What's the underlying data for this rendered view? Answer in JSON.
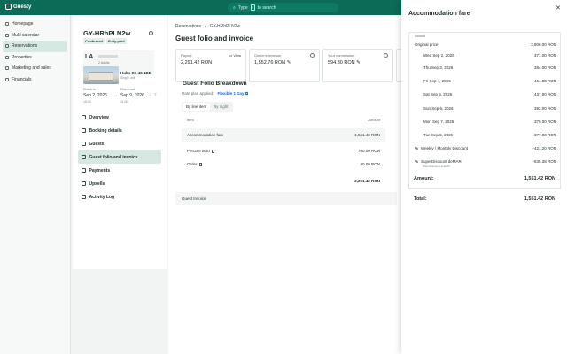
{
  "app": {
    "brand": "Guesty"
  },
  "search": {
    "label": "Type",
    "key": "/",
    "suffix": "to search"
  },
  "sidebar": {
    "items": [
      {
        "label": "Homepage"
      },
      {
        "label": "Multi calendar"
      },
      {
        "label": "Reservations"
      },
      {
        "label": "Properties"
      },
      {
        "label": "Marketing and sales"
      },
      {
        "label": "Financials"
      }
    ]
  },
  "reservation": {
    "code": "GY-HRhPLN2w",
    "status": "Confirmed",
    "payment": "Fully paid",
    "guest_initials": "LA",
    "guest_meta": "2 Adults",
    "unit_name": "Hubs C1-46 1BD",
    "unit_sub": "Single unit",
    "checkin_label": "Check-in",
    "checkin_date": "Sep 2, 2026",
    "checkin_time": "15:00",
    "checkout_label": "Check-out",
    "checkout_date": "Sep 9, 2026",
    "checkout_time": "11:00",
    "nights": "7",
    "nav": [
      {
        "label": "Overview"
      },
      {
        "label": "Booking details"
      },
      {
        "label": "Guests"
      },
      {
        "label": "Guest folio and invoice"
      },
      {
        "label": "Payments"
      },
      {
        "label": "Upsells"
      },
      {
        "label": "Activity Log"
      }
    ]
  },
  "main": {
    "breadcrumb": [
      "Reservations",
      "/",
      "GY-HRhPLN2w"
    ],
    "title": "Guest folio and invoice",
    "cards": [
      {
        "label": "Payout",
        "value": "2,291.42 RON",
        "extra": "View"
      },
      {
        "label": "Owner's revenue",
        "value": "1,552.76 RON"
      },
      {
        "label": "Your commission",
        "value": "594.30 RON"
      },
      {
        "label": "",
        "value": ""
      }
    ],
    "breakdown_title": "Guest Folio Breakdown",
    "rate_plan_label": "Rate plan applied:",
    "rate_plan": "Flexible 1 Day",
    "tabs": [
      "By line item",
      "By night"
    ],
    "table_head": {
      "item": "Item",
      "amount": "Amount"
    },
    "rows": [
      {
        "item": "Accommodation fare",
        "amount": "1,551.42 RON"
      },
      {
        "item": "Percare auto",
        "amount": "700.00 RON"
      },
      {
        "item": "Order",
        "amount": "40.00 RON"
      },
      {
        "item": "",
        "amount": "2,291.42 RON"
      }
    ],
    "guest_invoice": "Guest Invoice"
  },
  "panel": {
    "title": "Accommodation fare",
    "amount_label": "Amount",
    "original_label": "Original price",
    "original_value": "2,808.00 RON",
    "nights": [
      {
        "date": "Wed Sep 2, 2026",
        "amount": "371.00 RON"
      },
      {
        "date": "Thu Sep 3, 2026",
        "amount": "384.00 RON"
      },
      {
        "date": "Fri Sep 4, 2026",
        "amount": "464.00 RON"
      },
      {
        "date": "Sat Sep 5, 2026",
        "amount": "437.00 RON"
      },
      {
        "date": "Sun Sep 6, 2026",
        "amount": "392.00 RON"
      },
      {
        "date": "Mon Sep 7, 2026",
        "amount": "379.00 RON"
      },
      {
        "date": "Tue Sep 8, 2026",
        "amount": "377.00 RON"
      }
    ],
    "discounts": [
      {
        "label": "Weekly / Monthly Discount",
        "sub": "",
        "amount": "-421.20 RON"
      },
      {
        "label": "SuperDiscount deMAR",
        "sub": "SuperDiscount deMAR",
        "amount": "-835.38 RON"
      }
    ],
    "amount_total_label": "Amount:",
    "amount_total": "1,551.42 RON",
    "total_label": "Total:",
    "total": "1,551.42 RON"
  }
}
